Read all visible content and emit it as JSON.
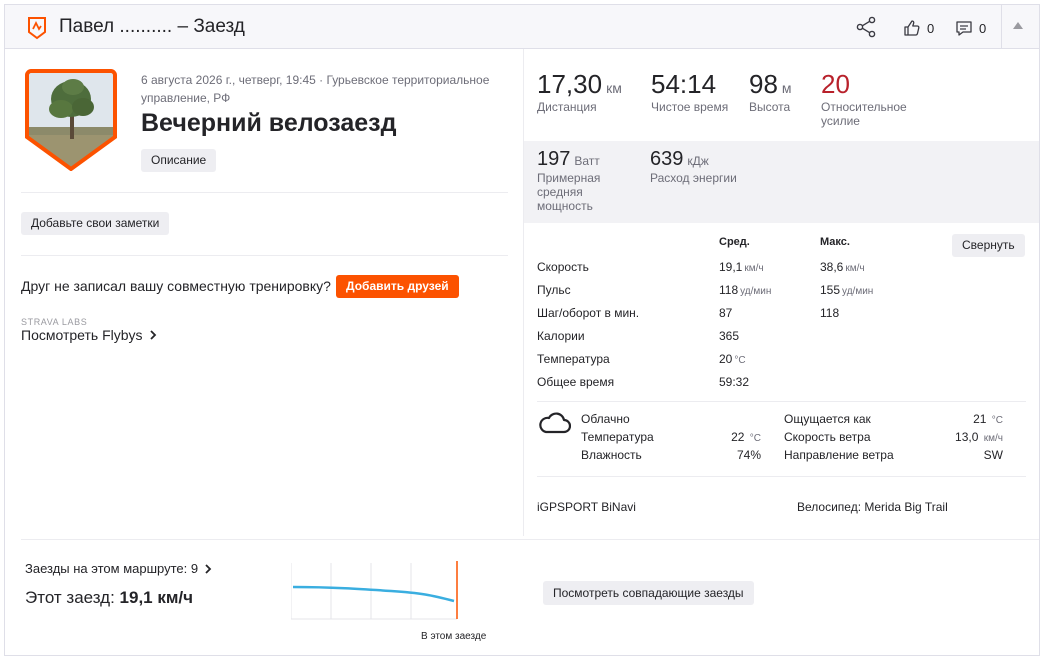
{
  "header": {
    "title": "Павел .......... – Заезд",
    "kudos_count": "0",
    "comments_count": "0"
  },
  "activity": {
    "meta": "6 августа 2026 г., четверг, 19:45 · Гурьевское территориальное управление, РФ",
    "title": "Вечерний велозаезд",
    "description_button": "Описание",
    "notes_button": "Добавьте свои заметки",
    "friend_prompt": "Друг не записал вашу совместную тренировку?",
    "add_friends_button": "Добавить друзей",
    "labs_caption": "STRAVA LABS",
    "flybys_prefix": "Посмотреть ",
    "flybys_name": "Flybys"
  },
  "stats": {
    "distance": {
      "value": "17,30",
      "unit": "км",
      "label": "Дистанция"
    },
    "moving_time": {
      "value": "54:14",
      "label": "Чистое время"
    },
    "elevation": {
      "value": "98",
      "unit": "м",
      "label": "Высота"
    },
    "relative_effort": {
      "value": "20",
      "label": "Относительное усилие"
    },
    "power": {
      "value": "197",
      "unit": "Ватт",
      "label": "Примерная средняя мощность"
    },
    "energy": {
      "value": "639",
      "unit": "кДж",
      "label": "Расход энергии"
    }
  },
  "table": {
    "col_avg": "Сред.",
    "col_max": "Макс.",
    "collapse_button": "Свернуть",
    "rows": [
      {
        "label": "Скорость",
        "avg": "19,1",
        "avg_unit": "км/ч",
        "max": "38,6",
        "max_unit": "км/ч"
      },
      {
        "label": "Пульс",
        "avg": "118",
        "avg_unit": "уд/мин",
        "max": "155",
        "max_unit": "уд/мин"
      },
      {
        "label": "Шаг/оборот в мин.",
        "avg": "87",
        "avg_unit": "",
        "max": "118",
        "max_unit": ""
      },
      {
        "label": "Калории",
        "avg": "365",
        "avg_unit": "",
        "max": "",
        "max_unit": ""
      },
      {
        "label": "Температура",
        "avg": "20",
        "avg_unit": "°С",
        "max": "",
        "max_unit": ""
      },
      {
        "label": "Общее время",
        "avg": "59:32",
        "avg_unit": "",
        "max": "",
        "max_unit": ""
      }
    ]
  },
  "weather": {
    "condition": "Облачно",
    "temp_label": "Температура",
    "temp_value": "22",
    "temp_unit": "°С",
    "humidity_label": "Влажность",
    "humidity_value": "74%",
    "feels_label": "Ощущается как",
    "feels_value": "21",
    "feels_unit": "°С",
    "wind_speed_label": "Скорость ветра",
    "wind_speed_value": "13,0",
    "wind_speed_unit": "км/ч",
    "wind_dir_label": "Направление ветра",
    "wind_dir_value": "SW"
  },
  "gear": {
    "device": "iGPSPORT BiNavi",
    "bike_label": "Велосипед: ",
    "bike_name": "Merida Big Trail"
  },
  "segment": {
    "rides_text": "Заезды на этом маршруте: 9",
    "this_ride_label": "Этот заезд: ",
    "this_ride_value": "19,1 км/ч",
    "chart_marker_label": "В этом заезде",
    "match_button": "Посмотреть совпадающие заезды"
  },
  "colors": {
    "accent": "#fc5200",
    "effort": "#b8212b",
    "trend_line": "#3aaee0"
  },
  "icons": {
    "sport": "bike-activity-icon",
    "share": "share-icon",
    "kudos": "thumbs-up-icon",
    "comments": "comment-icon",
    "weather": "cloud-icon"
  }
}
